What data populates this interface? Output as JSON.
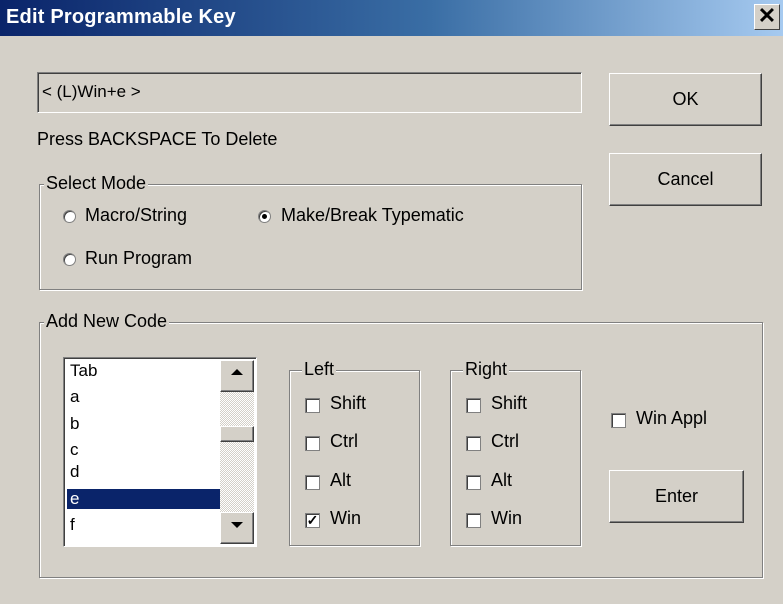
{
  "window": {
    "title": "Edit Programmable Key",
    "close_glyph": "✕"
  },
  "key_field": {
    "value": "< (L)Win+e >"
  },
  "hint": "Press BACKSPACE To Delete",
  "buttons": {
    "ok": "OK",
    "cancel": "Cancel",
    "enter": "Enter"
  },
  "select_mode": {
    "legend": "Select Mode",
    "options": [
      {
        "label": "Macro/String",
        "selected": false
      },
      {
        "label": "Make/Break Typematic",
        "selected": true
      },
      {
        "label": "Run Program",
        "selected": false
      }
    ]
  },
  "add_new_code": {
    "legend": "Add New Code",
    "list_items": [
      "Tab",
      "a",
      "b",
      "c",
      "d",
      "e",
      "f"
    ],
    "selected_item": "e",
    "left": {
      "legend": "Left",
      "items": [
        {
          "label": "Shift",
          "checked": false
        },
        {
          "label": "Ctrl",
          "checked": false
        },
        {
          "label": "Alt",
          "checked": false
        },
        {
          "label": "Win",
          "checked": true
        }
      ]
    },
    "right": {
      "legend": "Right",
      "items": [
        {
          "label": "Shift",
          "checked": false
        },
        {
          "label": "Ctrl",
          "checked": false
        },
        {
          "label": "Alt",
          "checked": false
        },
        {
          "label": "Win",
          "checked": false
        }
      ]
    },
    "win_appl": {
      "label": "Win Appl",
      "checked": false
    }
  },
  "colors": {
    "face": "#d4d0c8",
    "title_start": "#0a246a",
    "title_end": "#a6caf0",
    "selection": "#0a246a"
  },
  "icons": {
    "close": "close-icon",
    "scroll_up": "scroll-up-arrow-icon",
    "scroll_down": "scroll-down-arrow-icon",
    "check": "checkmark-icon"
  }
}
